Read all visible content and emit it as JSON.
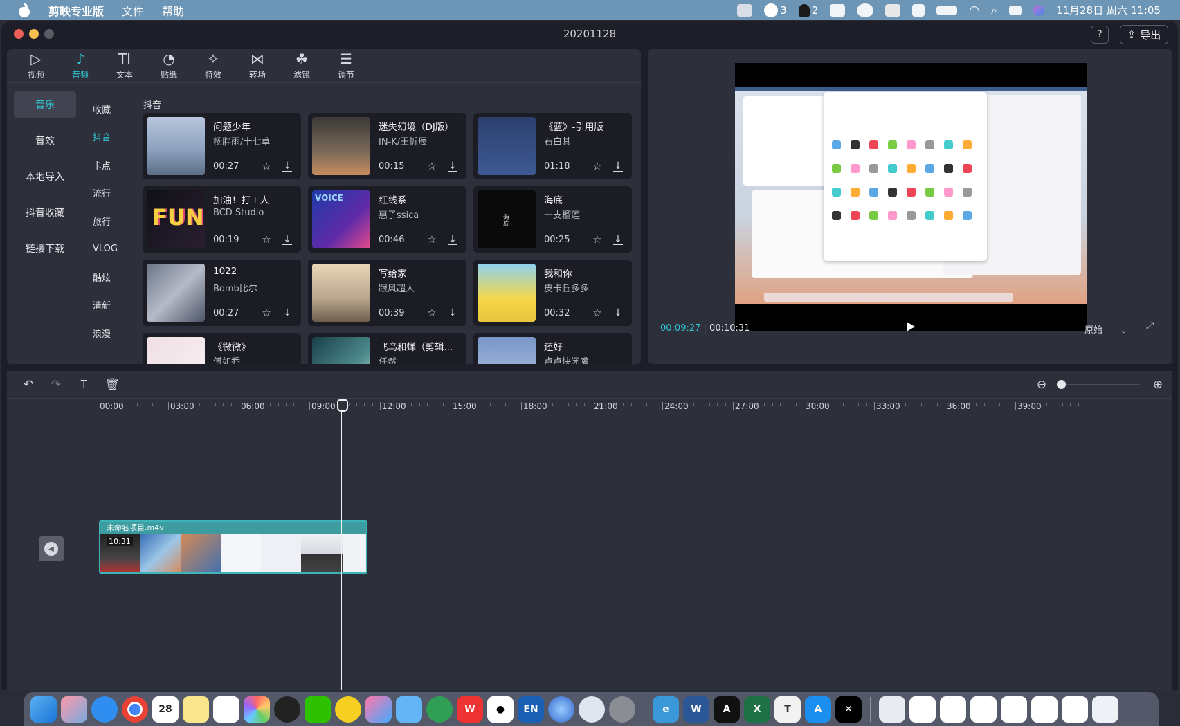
{
  "menubar": {
    "app_name": "剪映专业版",
    "menus": [
      "文件",
      "帮助"
    ],
    "wechat_count": "3",
    "notif_count": "2",
    "datetime": "11月28日 周六  11:05"
  },
  "window": {
    "title": "20201128",
    "help_label": "?",
    "export_label": "导出"
  },
  "toolbar": [
    {
      "icon": "video-icon",
      "glyph": "▷",
      "label": "视频"
    },
    {
      "icon": "audio-icon",
      "glyph": "♪",
      "label": "音频"
    },
    {
      "icon": "text-icon",
      "glyph": "TI",
      "label": "文本"
    },
    {
      "icon": "sticker-icon",
      "glyph": "◔",
      "label": "贴纸"
    },
    {
      "icon": "effects-icon",
      "glyph": "✧",
      "label": "特效"
    },
    {
      "icon": "transition-icon",
      "glyph": "⋈",
      "label": "转场"
    },
    {
      "icon": "filter-icon",
      "glyph": "☘",
      "label": "滤镜"
    },
    {
      "icon": "adjust-icon",
      "glyph": "☰",
      "label": "调节"
    }
  ],
  "categories": [
    "音乐",
    "音效",
    "本地导入",
    "抖音收藏",
    "链接下载"
  ],
  "subcategories": [
    "收藏",
    "抖音",
    "卡点",
    "流行",
    "旅行",
    "VLOG",
    "酷炫",
    "清新",
    "浪漫"
  ],
  "grid_title": "抖音",
  "tracks": [
    {
      "name": "问题少年",
      "artist": "杨胖雨/十七草",
      "duration": "00:27"
    },
    {
      "name": "迷失幻境（DJ版）",
      "artist": "IN-K/王忻辰",
      "duration": "00:15"
    },
    {
      "name": "《蓝》-引用版",
      "artist": "石白其",
      "duration": "01:18"
    },
    {
      "name": "加油！打工人",
      "artist": "BCD Studio",
      "duration": "00:19",
      "thumb_text": "FUN"
    },
    {
      "name": "红线系",
      "artist": "惠子ssica",
      "duration": "00:46",
      "thumb_text": "VOICE"
    },
    {
      "name": "海底",
      "artist": "一支榴莲",
      "duration": "00:25",
      "thumb_text": "海底"
    },
    {
      "name": "1022",
      "artist": "Bomb比尔",
      "duration": "00:27"
    },
    {
      "name": "写给家",
      "artist": "跟风超人",
      "duration": "00:39"
    },
    {
      "name": "我和你",
      "artist": "皮卡丘多多",
      "duration": "00:32"
    },
    {
      "name": "《微微》",
      "artist": "傅如乔",
      "duration": ""
    },
    {
      "name": "飞鸟和蝉（剪辑...",
      "artist": "任然",
      "duration": ""
    },
    {
      "name": "还好",
      "artist": "卢卢快闭嘴",
      "duration": ""
    }
  ],
  "preview": {
    "current_time": "00:09:27",
    "total_time": "00:10:31",
    "ratio_label": "原始"
  },
  "timeline": {
    "ticks": [
      "00:00",
      "03:00",
      "06:00",
      "09:00",
      "12:00",
      "15:00",
      "18:00",
      "21:00",
      "24:00",
      "27:00",
      "30:00",
      "33:00",
      "36:00",
      "39:00"
    ],
    "clip_name": "未命名项目.m4v",
    "clip_duration": "10:31",
    "zoom_level": 0.05
  },
  "dock": {
    "calendar_day": "28",
    "input_method": "EN"
  },
  "colors": {
    "accent": "#2fc5d1",
    "panel": "#2d2f3b",
    "window": "#1d1e28",
    "menubar": "#6d95b5"
  }
}
